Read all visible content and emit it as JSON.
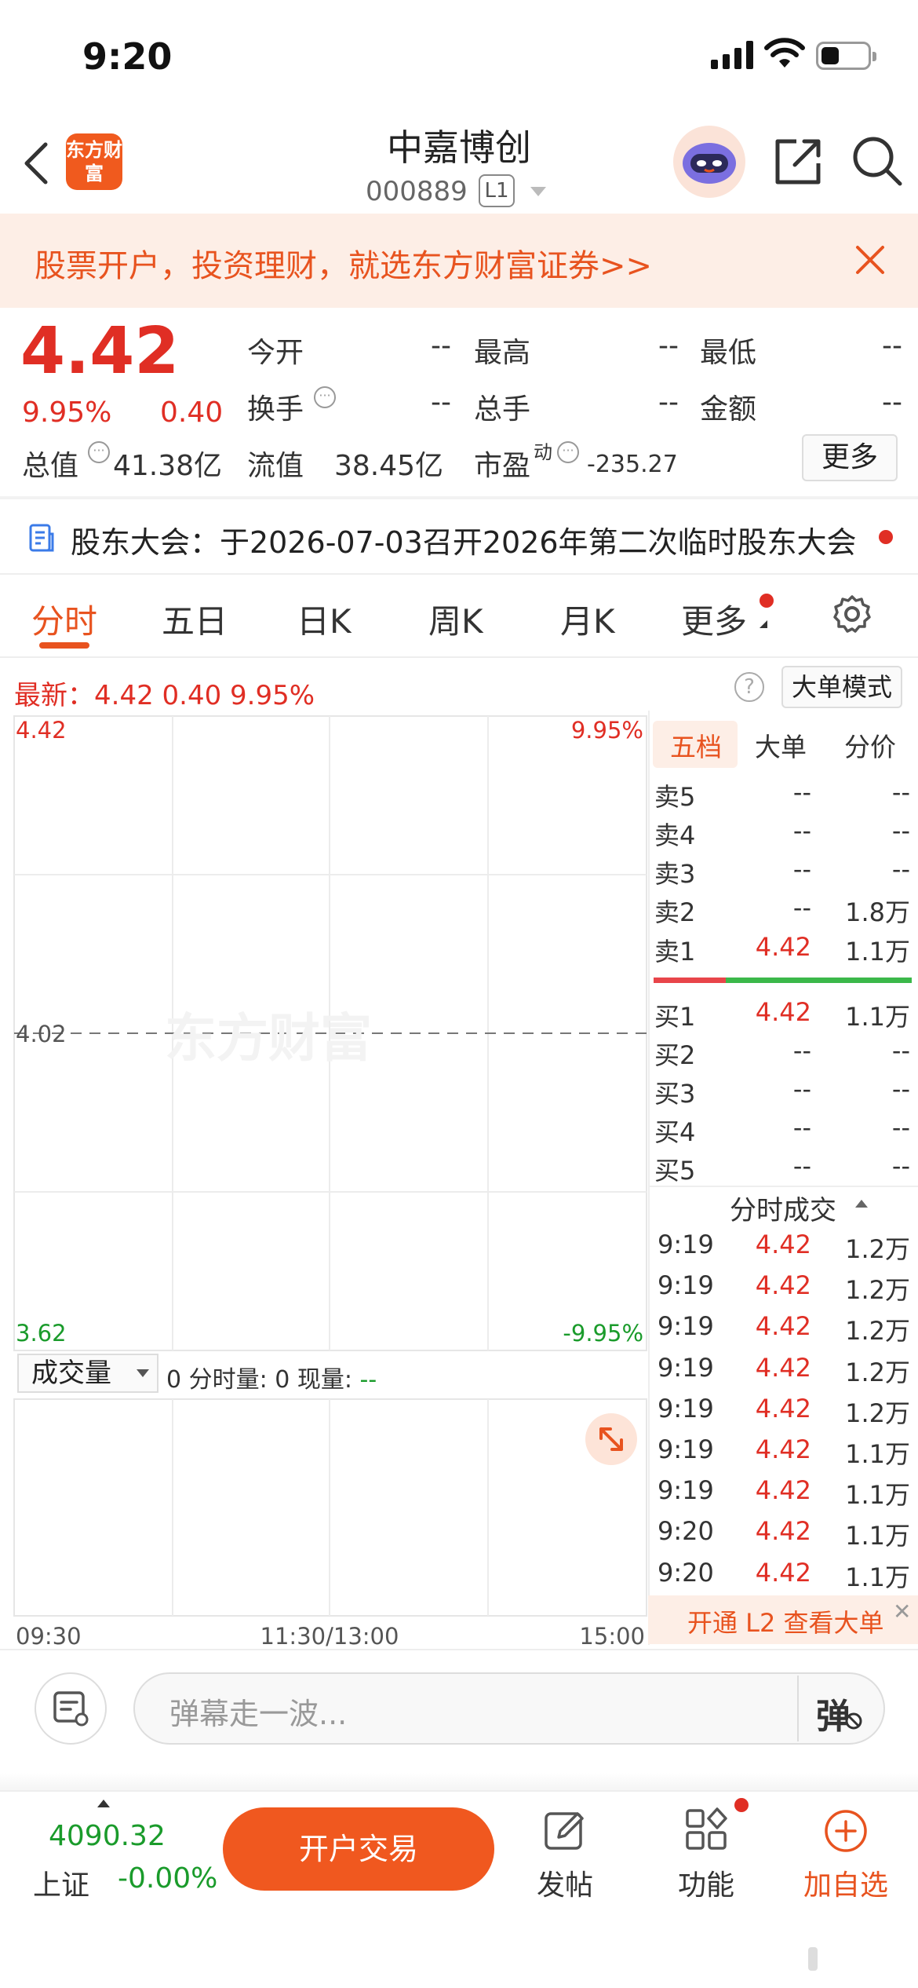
{
  "status_bar": {
    "time": "9:20"
  },
  "header": {
    "logo_text": "东方财富",
    "stock_name": "中嘉博创",
    "stock_code": "000889",
    "level_badge": "L1"
  },
  "banner": {
    "text": "股票开户，投资理财，就选东方财富证券>>"
  },
  "quote": {
    "price": "4.42",
    "change_pct": "9.95%",
    "change": "0.40",
    "open_label": "今开",
    "open_value": "--",
    "high_label": "最高",
    "high_value": "--",
    "low_label": "最低",
    "low_value": "--",
    "turnover_label": "换手",
    "turnover_value": "--",
    "volume_label": "总手",
    "volume_value": "--",
    "amount_label": "金额",
    "amount_value": "--",
    "mktcap_label": "总值",
    "mktcap_value": "41.38亿",
    "float_label": "流值",
    "float_value": "38.45亿",
    "pe_label": "市盈",
    "pe_sup": "动",
    "pe_value": "-235.27",
    "more_button": "更多"
  },
  "notice": {
    "text": "股东大会：于2026-07-03召开2026年第二次临时股东大会"
  },
  "tabs": [
    "分时",
    "五日",
    "日K",
    "周K",
    "月K",
    "更多"
  ],
  "latest": {
    "text": "最新：4.42  0.40  9.95%"
  },
  "big_order_mode": "大单模式",
  "chart": {
    "price_top": "4.42",
    "pct_top": "9.95%",
    "price_mid": "4.02",
    "price_bottom": "3.62",
    "pct_bottom": "-9.95%",
    "watermark": "东方财富",
    "time_start": "09:30",
    "time_mid": "11:30/13:00",
    "time_end": "15:00",
    "volume_selector": "成交量",
    "volume_info": "0 分时量: 0 现量: ",
    "volume_info_value": "--"
  },
  "order_book": {
    "tabs": [
      "五档",
      "大单",
      "分价"
    ],
    "asks": [
      {
        "label": "卖5",
        "price": "--",
        "volume": "--"
      },
      {
        "label": "卖4",
        "price": "--",
        "volume": "--"
      },
      {
        "label": "卖3",
        "price": "--",
        "volume": "--"
      },
      {
        "label": "卖2",
        "price": "--",
        "volume": "1.8万"
      },
      {
        "label": "卖1",
        "price": "4.42",
        "volume": "1.1万"
      }
    ],
    "bids": [
      {
        "label": "买1",
        "price": "4.42",
        "volume": "1.1万"
      },
      {
        "label": "买2",
        "price": "--",
        "volume": "--"
      },
      {
        "label": "买3",
        "price": "--",
        "volume": "--"
      },
      {
        "label": "买4",
        "price": "--",
        "volume": "--"
      },
      {
        "label": "买5",
        "price": "--",
        "volume": "--"
      }
    ],
    "ticks_title": "分时成交",
    "ticks": [
      {
        "time": "9:19",
        "price": "4.42",
        "volume": "1.2万"
      },
      {
        "time": "9:19",
        "price": "4.42",
        "volume": "1.2万"
      },
      {
        "time": "9:19",
        "price": "4.42",
        "volume": "1.2万"
      },
      {
        "time": "9:19",
        "price": "4.42",
        "volume": "1.2万"
      },
      {
        "time": "9:19",
        "price": "4.42",
        "volume": "1.2万"
      },
      {
        "time": "9:19",
        "price": "4.42",
        "volume": "1.1万"
      },
      {
        "time": "9:19",
        "price": "4.42",
        "volume": "1.1万"
      },
      {
        "time": "9:20",
        "price": "4.42",
        "volume": "1.1万"
      },
      {
        "time": "9:20",
        "price": "4.42",
        "volume": "1.1万"
      }
    ],
    "l2_banner": "开通 L2 查看大单"
  },
  "danmaku": {
    "placeholder": "弹幕走一波...",
    "button": "弹"
  },
  "bottom_bar": {
    "index_value": "4090.32",
    "index_name": "上证",
    "index_change": "-0.00%",
    "trade_button": "开户交易",
    "post": "发帖",
    "functions": "功能",
    "add_watch": "加自选"
  },
  "colors": {
    "up": "#e02e24",
    "down": "#1a9b2b",
    "accent": "#f0581f",
    "banner_bg": "#fdeee6"
  }
}
